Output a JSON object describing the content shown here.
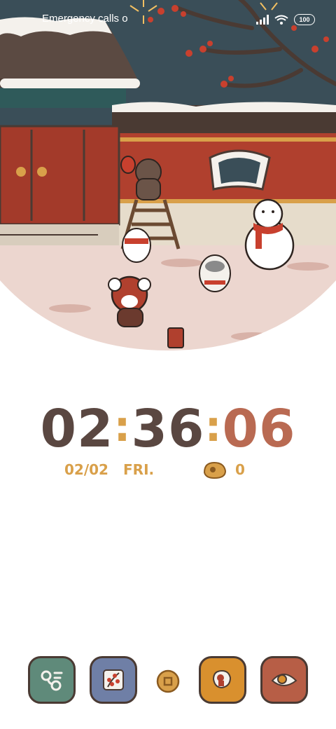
{
  "status_bar": {
    "left_text": "Emergency calls only",
    "battery_level": "100",
    "icons": [
      "signal-icon",
      "wifi-icon",
      "battery-icon"
    ]
  },
  "clock": {
    "hours": "02",
    "minutes": "36",
    "seconds": "06",
    "separator": ":"
  },
  "date_row": {
    "date": "02/02",
    "day": "FRI.",
    "coin_count": "0"
  },
  "dock": {
    "apps": [
      {
        "name": "phone",
        "icon": "phone-icon"
      },
      {
        "name": "gallery",
        "icon": "gallery-icon"
      },
      {
        "name": "coin",
        "icon": "coin-icon"
      },
      {
        "name": "store",
        "icon": "shopping-bag-icon"
      },
      {
        "name": "camera",
        "icon": "eye-icon"
      }
    ]
  },
  "colors": {
    "clock_dark": "#5a4741",
    "clock_seconds": "#b96a52",
    "accent_gold": "#d9a04a",
    "sky": "#3a4e58",
    "wall_red": "#b0402e"
  }
}
